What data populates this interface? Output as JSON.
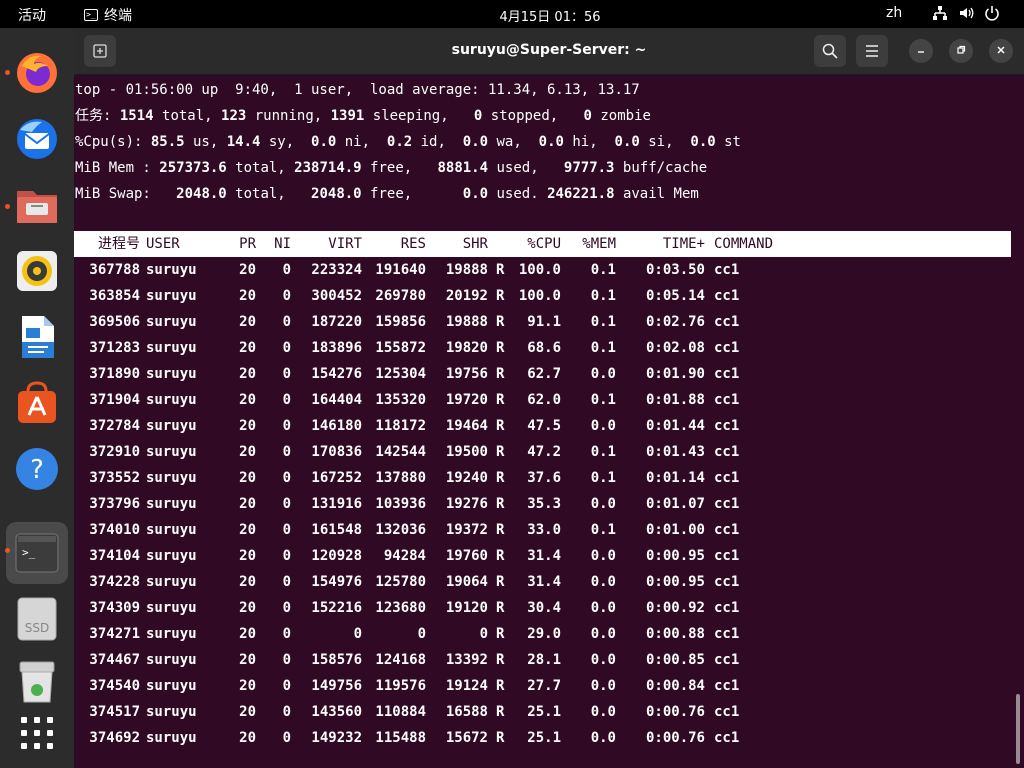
{
  "topbar": {
    "activities": "活动",
    "app_name": "终端",
    "clock": "4月15日  01：56",
    "lang": "zh"
  },
  "window": {
    "title": "suruyu@Super-Server: ~"
  },
  "top": {
    "line1": "top - 01:56:00 up  9:40,  1 user,  load average: 11.34, 6.13, 13.17",
    "tasks": {
      "label": "任务:",
      "total": "1514",
      "running": "123",
      "sleeping": "1391",
      "stopped": "0",
      "zombie": "0"
    },
    "cpu": {
      "us": "85.5",
      "sy": "14.4",
      "ni": "0.0",
      "id": "0.2",
      "wa": "0.0",
      "hi": "0.0",
      "si": "0.0",
      "st": "0.0"
    },
    "mem": {
      "total": "257373.6",
      "free": "238714.9",
      "used": "8881.4",
      "buff_cache": "9777.3"
    },
    "swap": {
      "total": "2048.0",
      "free": "2048.0",
      "used": "0.0",
      "avail": "246221.8"
    }
  },
  "columns": [
    "进程号",
    "USER",
    "PR",
    "NI",
    "VIRT",
    "RES",
    "SHR",
    "",
    "%CPU",
    "%MEM",
    "TIME+",
    "COMMAND"
  ],
  "processes": [
    [
      "367788",
      "suruyu",
      "20",
      "0",
      "223324",
      "191640",
      "19888",
      "R",
      "100.0",
      "0.1",
      "0:03.50",
      "cc1"
    ],
    [
      "363854",
      "suruyu",
      "20",
      "0",
      "300452",
      "269780",
      "20192",
      "R",
      "100.0",
      "0.1",
      "0:05.14",
      "cc1"
    ],
    [
      "369506",
      "suruyu",
      "20",
      "0",
      "187220",
      "159856",
      "19888",
      "R",
      "91.1",
      "0.1",
      "0:02.76",
      "cc1"
    ],
    [
      "371283",
      "suruyu",
      "20",
      "0",
      "183896",
      "155872",
      "19820",
      "R",
      "68.6",
      "0.1",
      "0:02.08",
      "cc1"
    ],
    [
      "371890",
      "suruyu",
      "20",
      "0",
      "154276",
      "125304",
      "19756",
      "R",
      "62.7",
      "0.0",
      "0:01.90",
      "cc1"
    ],
    [
      "371904",
      "suruyu",
      "20",
      "0",
      "164404",
      "135320",
      "19720",
      "R",
      "62.0",
      "0.1",
      "0:01.88",
      "cc1"
    ],
    [
      "372784",
      "suruyu",
      "20",
      "0",
      "146180",
      "118172",
      "19464",
      "R",
      "47.5",
      "0.0",
      "0:01.44",
      "cc1"
    ],
    [
      "372910",
      "suruyu",
      "20",
      "0",
      "170836",
      "142544",
      "19500",
      "R",
      "47.2",
      "0.1",
      "0:01.43",
      "cc1"
    ],
    [
      "373552",
      "suruyu",
      "20",
      "0",
      "167252",
      "137880",
      "19240",
      "R",
      "37.6",
      "0.1",
      "0:01.14",
      "cc1"
    ],
    [
      "373796",
      "suruyu",
      "20",
      "0",
      "131916",
      "103936",
      "19276",
      "R",
      "35.3",
      "0.0",
      "0:01.07",
      "cc1"
    ],
    [
      "374010",
      "suruyu",
      "20",
      "0",
      "161548",
      "132036",
      "19372",
      "R",
      "33.0",
      "0.1",
      "0:01.00",
      "cc1"
    ],
    [
      "374104",
      "suruyu",
      "20",
      "0",
      "120928",
      "94284",
      "19760",
      "R",
      "31.4",
      "0.0",
      "0:00.95",
      "cc1"
    ],
    [
      "374228",
      "suruyu",
      "20",
      "0",
      "154976",
      "125780",
      "19064",
      "R",
      "31.4",
      "0.0",
      "0:00.95",
      "cc1"
    ],
    [
      "374309",
      "suruyu",
      "20",
      "0",
      "152216",
      "123680",
      "19120",
      "R",
      "30.4",
      "0.0",
      "0:00.92",
      "cc1"
    ],
    [
      "374271",
      "suruyu",
      "20",
      "0",
      "0",
      "0",
      "0",
      "R",
      "29.0",
      "0.0",
      "0:00.88",
      "cc1"
    ],
    [
      "374467",
      "suruyu",
      "20",
      "0",
      "158576",
      "124168",
      "13392",
      "R",
      "28.1",
      "0.0",
      "0:00.85",
      "cc1"
    ],
    [
      "374540",
      "suruyu",
      "20",
      "0",
      "149756",
      "119576",
      "19124",
      "R",
      "27.7",
      "0.0",
      "0:00.84",
      "cc1"
    ],
    [
      "374517",
      "suruyu",
      "20",
      "0",
      "143560",
      "110884",
      "16588",
      "R",
      "25.1",
      "0.0",
      "0:00.76",
      "cc1"
    ],
    [
      "374692",
      "suruyu",
      "20",
      "0",
      "149232",
      "115488",
      "15672",
      "R",
      "25.1",
      "0.0",
      "0:00.76",
      "cc1"
    ]
  ],
  "dock": [
    {
      "name": "firefox-icon"
    },
    {
      "name": "thunderbird-icon"
    },
    {
      "name": "files-icon"
    },
    {
      "name": "rhythmbox-icon"
    },
    {
      "name": "writer-icon"
    },
    {
      "name": "app-center-icon"
    },
    {
      "name": "help-icon"
    },
    {
      "name": "terminal-icon"
    },
    {
      "name": "ssd-drive-icon",
      "label": "SSD"
    },
    {
      "name": "trash-icon"
    },
    {
      "name": "show-apps-icon"
    }
  ]
}
